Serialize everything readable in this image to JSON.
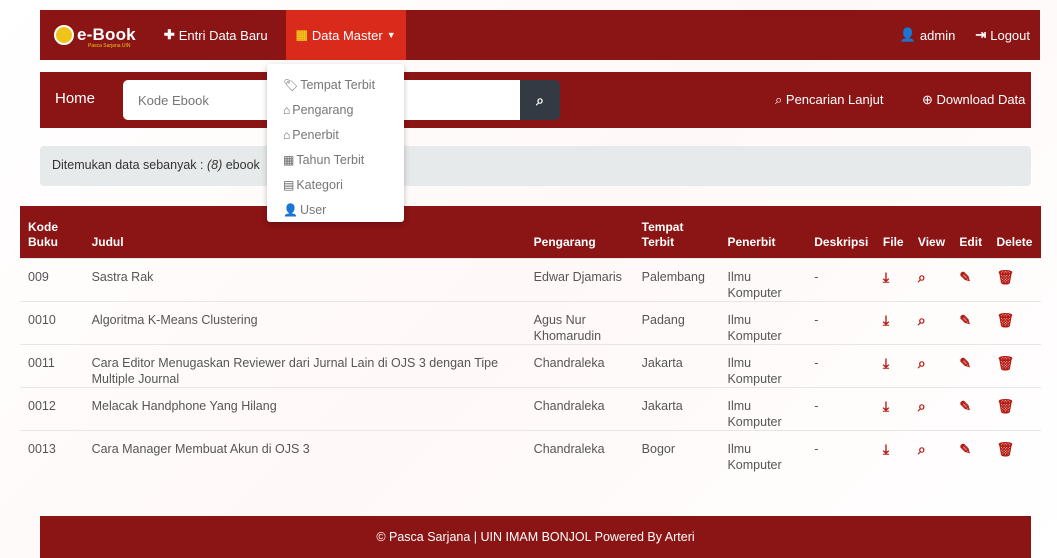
{
  "navbar": {
    "brand": "e-Book",
    "brand_sub": "Pasca Sarjana UIN",
    "entri_label": "Entri Data Baru",
    "entri_icon": "plus-icon",
    "master_label": "Data Master",
    "master_icon": "grid-icon",
    "admin_label": "admin",
    "logout_label": "Logout"
  },
  "search": {
    "home_label": "Home",
    "placeholder": "Kode Ebook",
    "advanced_label": "Pencarian Lanjut",
    "download_label": "Download Data"
  },
  "result": {
    "prefix": "Ditemukan data sebanyak : ",
    "count": "(8)",
    "suffix": " ebook"
  },
  "dropdown": {
    "items": [
      {
        "label": "Tempat Terbit",
        "icon": "tag-icon"
      },
      {
        "label": "Pengarang",
        "icon": "home-icon"
      },
      {
        "label": "Penerbit",
        "icon": "home-icon"
      },
      {
        "label": "Tahun Terbit",
        "icon": "grid-icon"
      },
      {
        "label": "Kategori",
        "icon": "film-icon"
      },
      {
        "label": "User",
        "icon": "user-icon"
      }
    ]
  },
  "table": {
    "headers": {
      "kode": "Kode Buku",
      "judul": "Judul",
      "pengarang": "Pengarang",
      "tempat": "Tempat Terbit",
      "penerbit": "Penerbit",
      "deskripsi": "Deskripsi",
      "file": "File",
      "view": "View",
      "edit": "Edit",
      "delete": "Delete"
    },
    "rows": [
      {
        "kode": "009",
        "judul": "Sastra Rak",
        "pengarang": "Edwar Djamaris",
        "tempat": "Palembang",
        "penerbit": "Ilmu Komputer",
        "deskripsi": "-"
      },
      {
        "kode": "0010",
        "judul": "Algoritma K-Means Clustering",
        "pengarang": "Agus Nur Khomarudin",
        "tempat": "Padang",
        "penerbit": "Ilmu Komputer",
        "deskripsi": "-"
      },
      {
        "kode": "0011",
        "judul": "Cara Editor Menugaskan Reviewer dari Jurnal Lain di OJS 3 dengan Tipe Multiple Journal",
        "pengarang": "Chandraleka",
        "tempat": "Jakarta",
        "penerbit": "Ilmu Komputer",
        "deskripsi": "-"
      },
      {
        "kode": "0012",
        "judul": "Melacak Handphone Yang Hilang",
        "pengarang": "Chandraleka",
        "tempat": "Jakarta",
        "penerbit": "Ilmu Komputer",
        "deskripsi": "-"
      },
      {
        "kode": "0013",
        "judul": "Cara Manager Membuat Akun di OJS 3",
        "pengarang": "Chandraleka",
        "tempat": "Bogor",
        "penerbit": "Ilmu Komputer",
        "deskripsi": "-"
      }
    ]
  },
  "footer": {
    "text": "© Pasca Sarjana | UIN IMAM BONJOL Powered By Arteri"
  },
  "colors": {
    "primary": "#8b1414",
    "active": "#d92a1c",
    "action": "#b31a12"
  }
}
